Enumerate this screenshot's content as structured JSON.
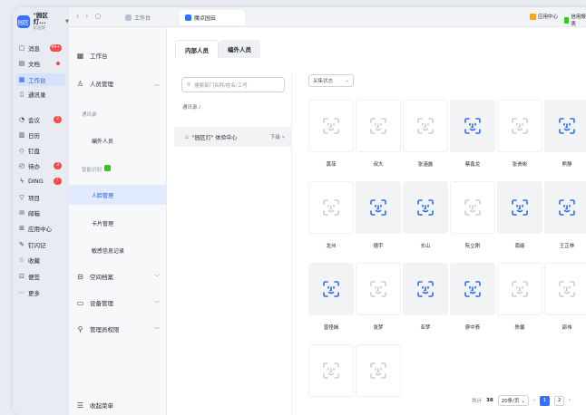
{
  "org": {
    "logo_text": "园区",
    "name": "\"园区灯...",
    "sub": "标准版"
  },
  "rail": [
    {
      "icon": "message-icon",
      "glyph": "▢",
      "label": "消息",
      "badge": "99+"
    },
    {
      "icon": "doc-icon",
      "glyph": "▤",
      "label": "文档",
      "dot": true
    },
    {
      "icon": "workbench-icon",
      "glyph": "▦",
      "label": "工作台",
      "active": true
    },
    {
      "icon": "contacts-icon",
      "glyph": "▯",
      "label": "通讯录"
    },
    {
      "icon": "meeting-icon",
      "glyph": "◔",
      "label": "会议",
      "badge": "2"
    },
    {
      "icon": "calendar-icon",
      "glyph": "▥",
      "label": "日历"
    },
    {
      "icon": "disk-icon",
      "glyph": "◇",
      "label": "钉盘"
    },
    {
      "icon": "todo-icon",
      "glyph": "◴",
      "label": "待办",
      "badge": "3"
    },
    {
      "icon": "ding-icon",
      "glyph": "ϟ",
      "label": "DING",
      "badge": "!"
    },
    {
      "icon": "project-icon",
      "glyph": "▽",
      "label": "项目"
    },
    {
      "icon": "mail-icon",
      "glyph": "✉",
      "label": "邮箱"
    },
    {
      "icon": "app-center-icon",
      "glyph": "⊞",
      "label": "应用中心"
    },
    {
      "icon": "note-icon",
      "glyph": "✎",
      "label": "钉闪记"
    },
    {
      "icon": "favorite-icon",
      "glyph": "☆",
      "label": "收藏"
    },
    {
      "icon": "memo-icon",
      "glyph": "⊡",
      "label": "便签"
    },
    {
      "icon": "more-icon",
      "glyph": "⋯",
      "label": "更多"
    }
  ],
  "topbar": {
    "tab1": "工作台",
    "tab2": "魔点园云",
    "btn_app_center": "应用中心",
    "btn_report": "信用报表"
  },
  "panel": {
    "workbench": "工作台",
    "personnel": "人员管理",
    "group_contacts": "通讯录",
    "external": "编外人员",
    "group_face": "智能识别",
    "person_manage": "人脸管理",
    "card_manage": "卡片管理",
    "sensitive": "敏感信息记录",
    "space": "空间档案",
    "device": "设备管理",
    "admin": "管理员权限",
    "collapse": "收起菜单"
  },
  "main": {
    "tab_internal": "内部人员",
    "tab_external": "编外人员",
    "search_placeholder": "搜索部门名称/姓名/工号",
    "crumb": "通讯录 /",
    "node_label": "\"园区灯\" 体验中心",
    "node_sub": "下级",
    "filter_label": "采集状态",
    "people": [
      {
        "name": "黄菲",
        "enrolled": false
      },
      {
        "name": "叔大",
        "enrolled": false
      },
      {
        "name": "张涵露",
        "enrolled": false
      },
      {
        "name": "蔡鑫龙",
        "enrolled": true
      },
      {
        "name": "张贵彬",
        "enrolled": false
      },
      {
        "name": "熊静",
        "enrolled": true
      },
      {
        "name": "龙州",
        "enrolled": false
      },
      {
        "name": "德宇",
        "enrolled": true
      },
      {
        "name": "长山",
        "enrolled": true
      },
      {
        "name": "阮立刚",
        "enrolled": false
      },
      {
        "name": "南能",
        "enrolled": true
      },
      {
        "name": "王芷林",
        "enrolled": true
      },
      {
        "name": "曾怪嫣",
        "enrolled": true
      },
      {
        "name": "张梦",
        "enrolled": false
      },
      {
        "name": "亚梦",
        "enrolled": true
      },
      {
        "name": "廖中荟",
        "enrolled": true
      },
      {
        "name": "陈馨",
        "enrolled": false
      },
      {
        "name": "邵伟",
        "enrolled": false
      },
      {
        "name": "",
        "enrolled": false
      },
      {
        "name": "",
        "enrolled": false
      }
    ],
    "pager": {
      "total_label": "共计",
      "total": "38",
      "page_size": "20条/页",
      "page1": "1",
      "page2": "2"
    }
  },
  "colors": {
    "accent": "#3370ff",
    "face_icon": "#2b6cf0",
    "face_icon_empty": "#c9cdd4"
  }
}
